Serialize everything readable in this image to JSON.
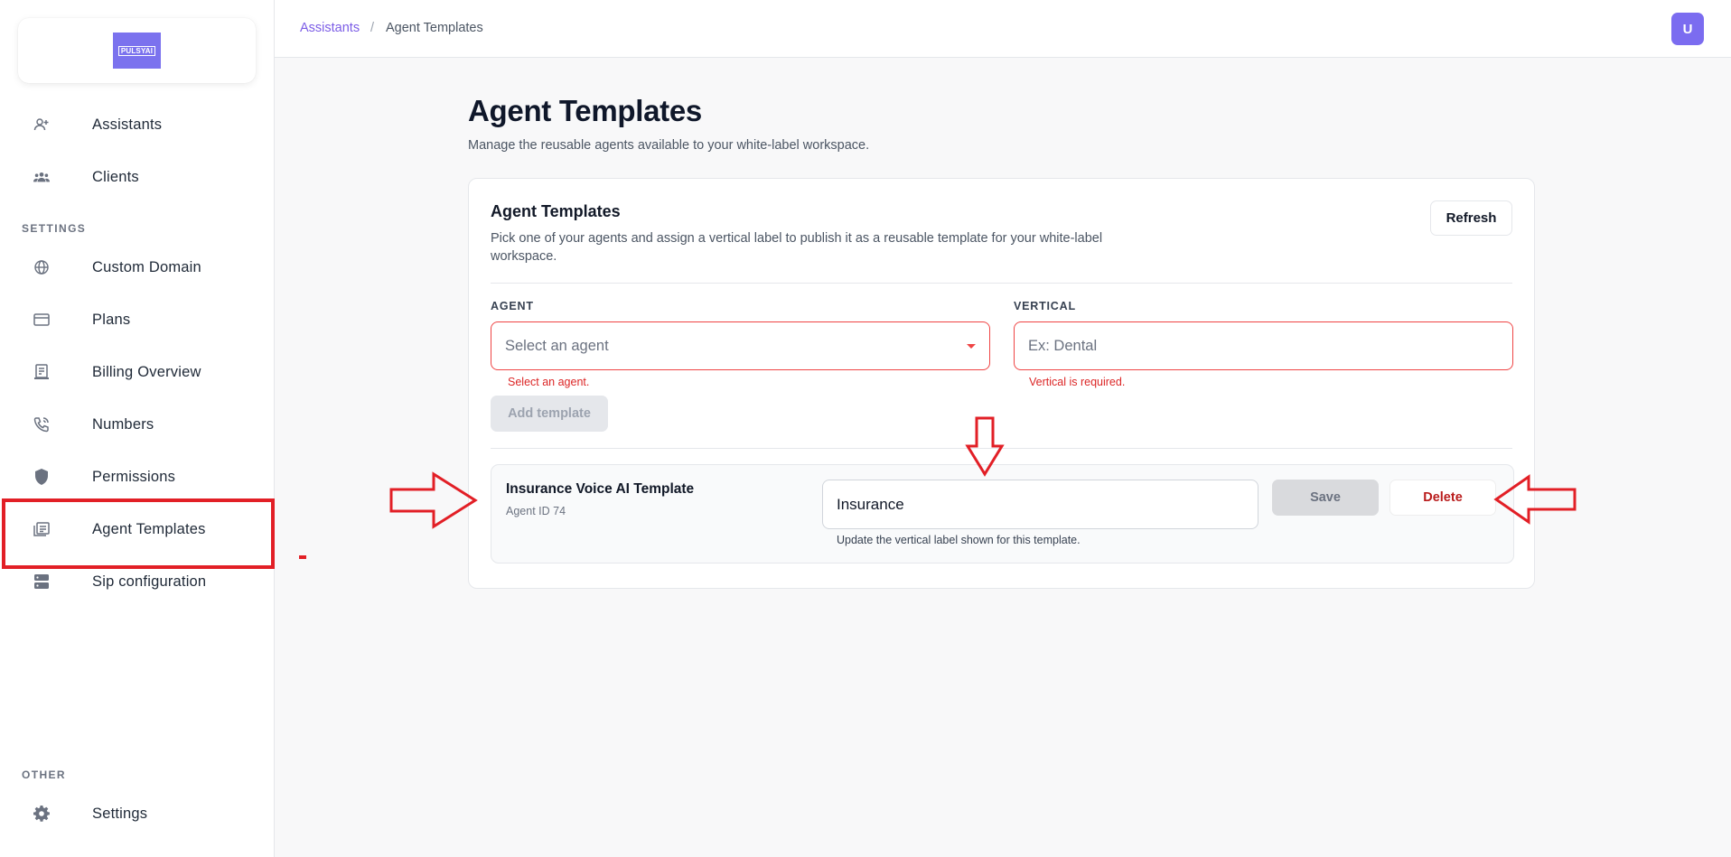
{
  "brand": {
    "logo_text": "PULSYAI",
    "accent_color": "#7b72ee"
  },
  "sidebar": {
    "items": [
      {
        "label": "Assistants",
        "icon": "add-user-icon"
      },
      {
        "label": "Clients",
        "icon": "group-icon"
      }
    ],
    "settings_section": "SETTINGS",
    "settings_items": [
      {
        "label": "Custom Domain",
        "icon": "globe-icon"
      },
      {
        "label": "Plans",
        "icon": "credit-card-icon"
      },
      {
        "label": "Billing Overview",
        "icon": "receipt-icon"
      },
      {
        "label": "Numbers",
        "icon": "phone-icon"
      },
      {
        "label": "Permissions",
        "icon": "shield-icon"
      },
      {
        "label": "Agent Templates",
        "icon": "template-icon",
        "active": true
      },
      {
        "label": "Sip configuration",
        "icon": "server-icon"
      }
    ],
    "other_section": "OTHER",
    "other_items": [
      {
        "label": "Settings",
        "icon": "gear-icon"
      }
    ]
  },
  "header": {
    "breadcrumb": {
      "link": "Assistants",
      "separator": "/",
      "current": "Agent Templates"
    },
    "avatar_initial": "U"
  },
  "main": {
    "title": "Agent Templates",
    "subtitle": "Manage the reusable agents available to your white-label workspace.",
    "card": {
      "title": "Agent Templates",
      "description": "Pick one of your agents and assign a vertical label to publish it as a reusable template for your white-label workspace.",
      "refresh_label": "Refresh",
      "agent_label": "AGENT",
      "agent_placeholder": "Select an agent",
      "agent_error": "Select an agent.",
      "vertical_label": "VERTICAL",
      "vertical_placeholder": "Ex: Dental",
      "vertical_error": "Vertical is required.",
      "add_label": "Add template"
    },
    "templates": [
      {
        "name": "Insurance Voice AI Template",
        "agent_id": "Agent ID 74",
        "vertical": "Insurance",
        "help": "Update the vertical label shown for this template.",
        "save_label": "Save",
        "delete_label": "Delete"
      }
    ]
  },
  "colors": {
    "error": "#ef4444",
    "annotation": "#e21f26",
    "delete": "#b91c1c"
  }
}
